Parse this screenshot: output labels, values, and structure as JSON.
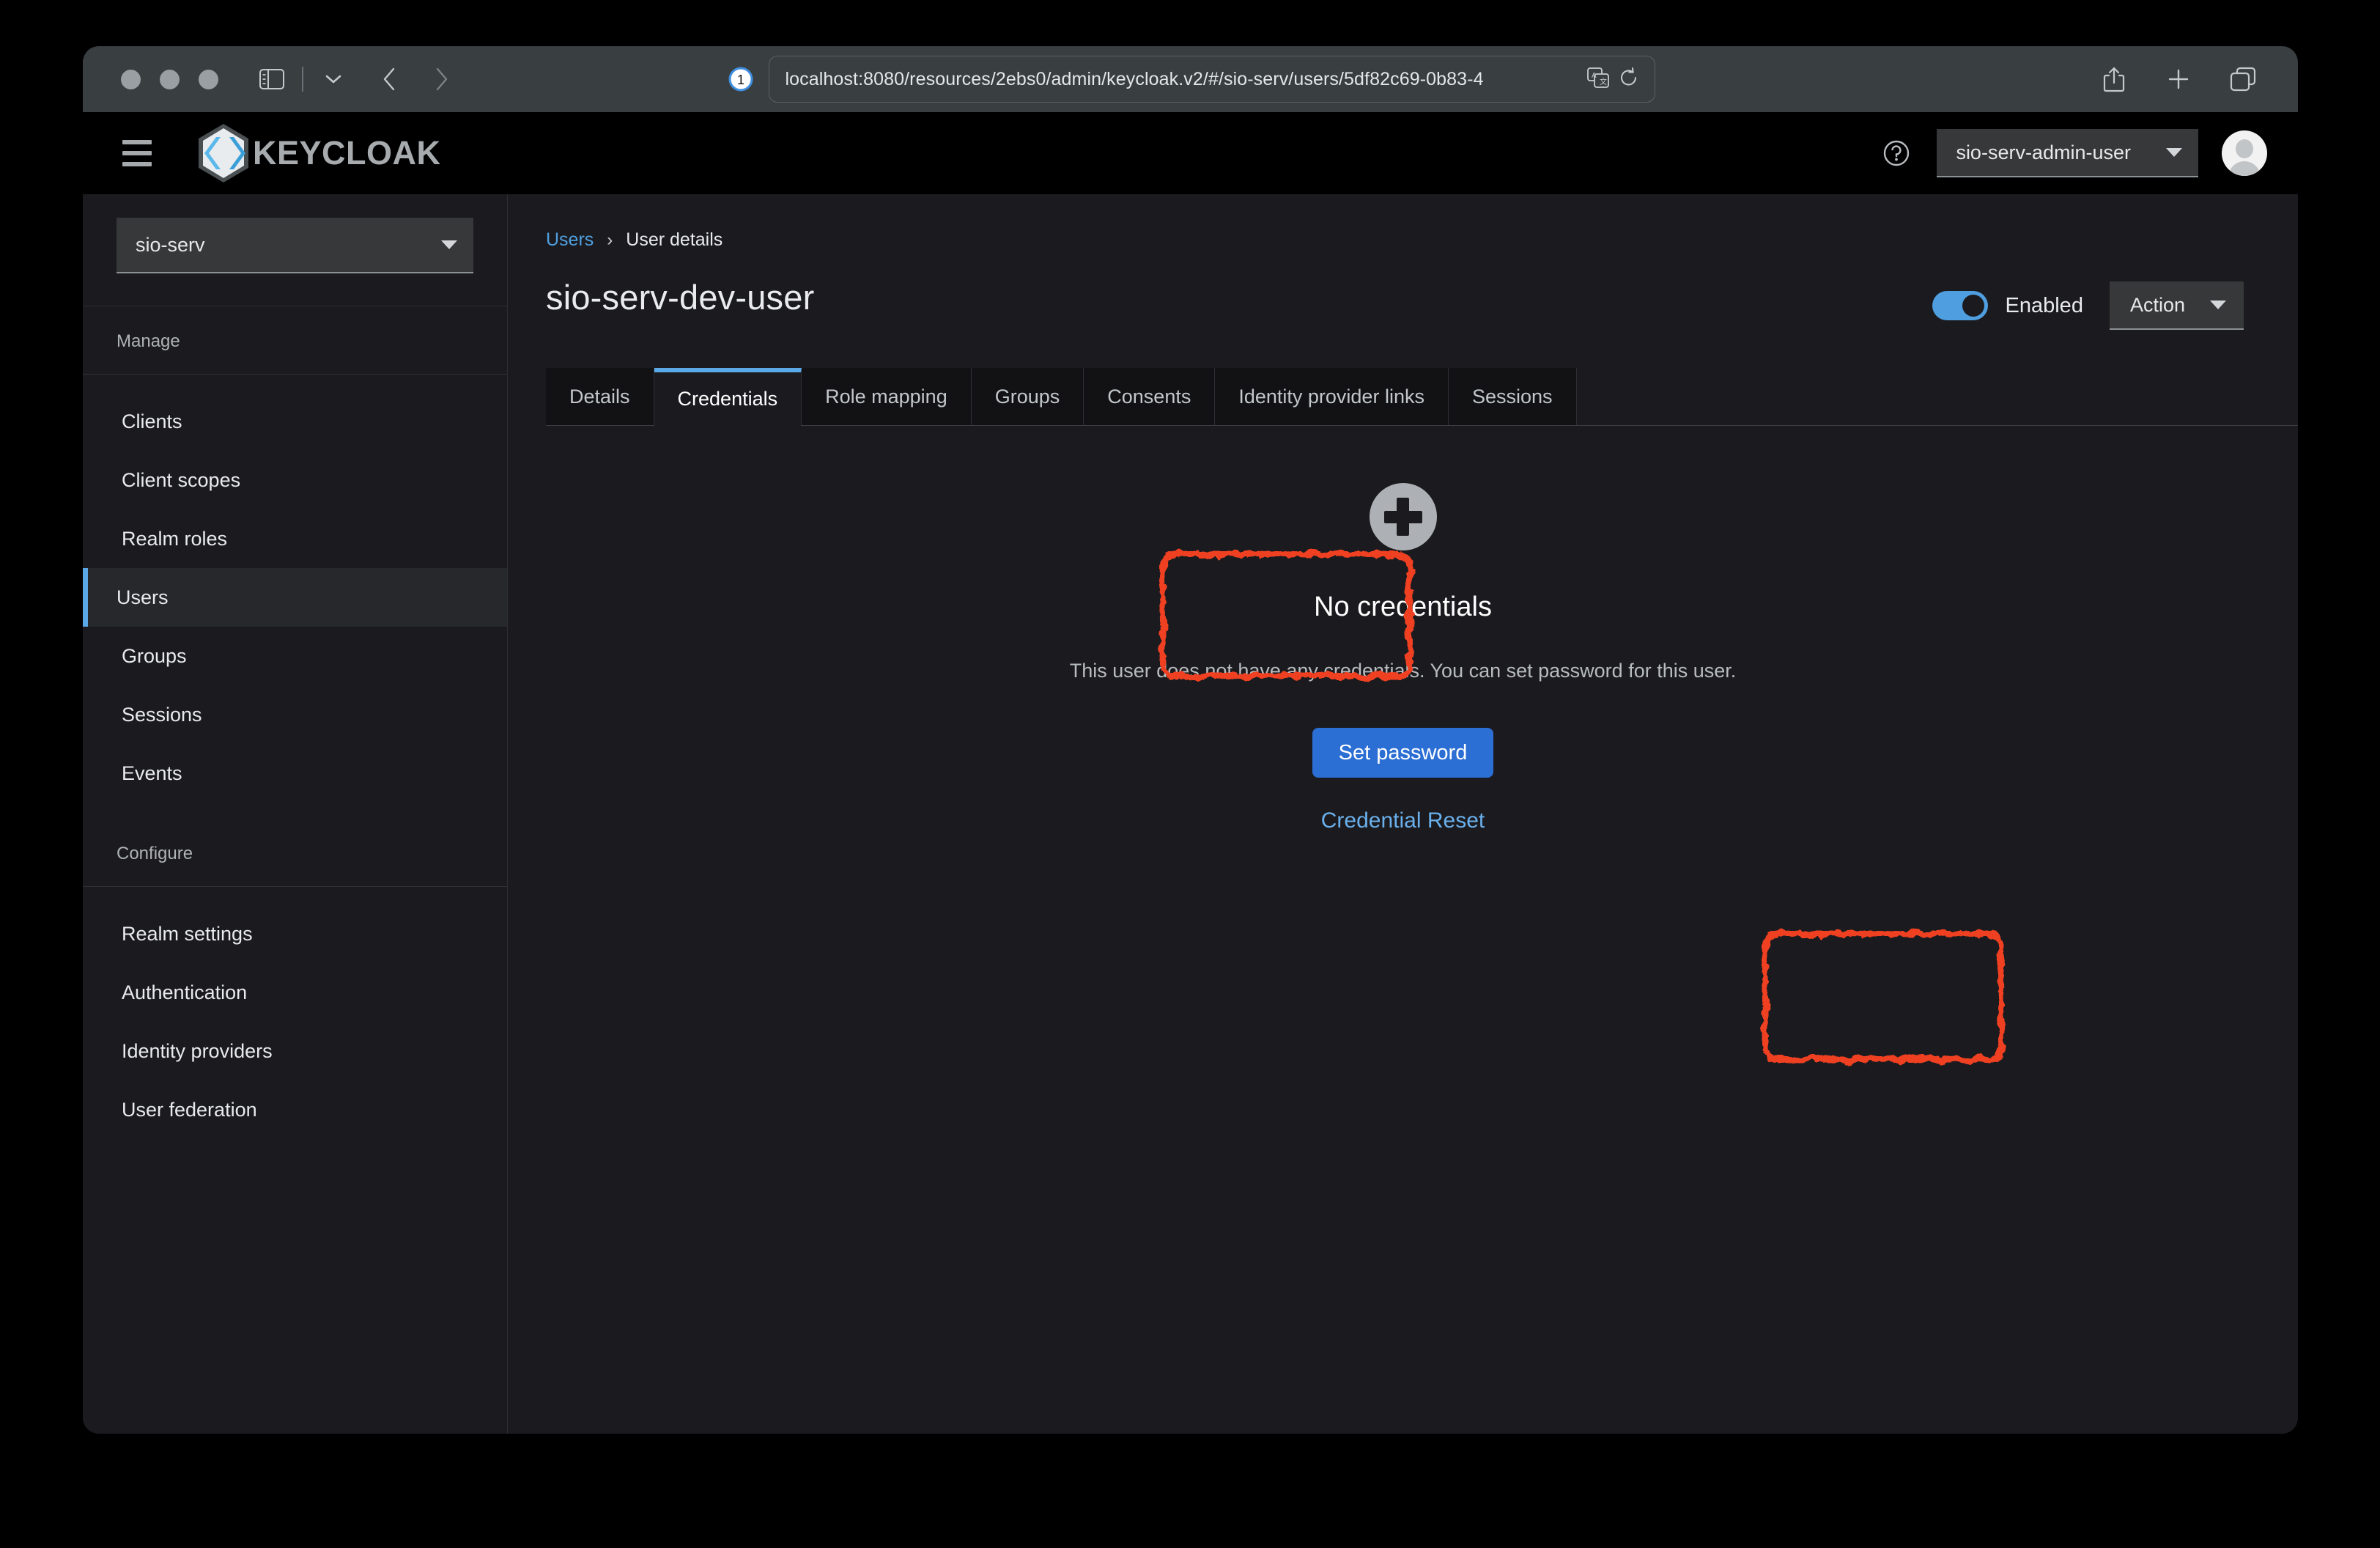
{
  "browser": {
    "url": "localhost:8080/resources/2ebs0/admin/keycloak.v2/#/sio-serv/users/5df82c69-0b83-4",
    "traffic_lights": [
      "close-button",
      "minimize-button",
      "maximize-button"
    ],
    "icons": {
      "sidebar_toggle": "sidebar-toggle-icon",
      "sidebar_chevron": "chevron-down-icon",
      "back": "back-arrow-icon",
      "forward": "forward-arrow-icon",
      "shield": "privacy-shield-icon",
      "translate": "translate-icon",
      "reload": "reload-icon",
      "share": "share-icon",
      "new_tab": "plus-icon",
      "tab_overview": "tab-overview-icon"
    }
  },
  "masthead": {
    "brand": "KEYCLOAK",
    "hamburger": "hamburger-menu-icon",
    "help": "help-circle-icon",
    "user": "sio-serv-admin-user",
    "avatar": "user-avatar"
  },
  "sidebar": {
    "realm": "sio-serv",
    "groups": [
      {
        "title": "Manage",
        "items": [
          {
            "label": "Clients",
            "active": false
          },
          {
            "label": "Client scopes",
            "active": false
          },
          {
            "label": "Realm roles",
            "active": false
          },
          {
            "label": "Users",
            "active": true
          },
          {
            "label": "Groups",
            "active": false
          },
          {
            "label": "Sessions",
            "active": false
          },
          {
            "label": "Events",
            "active": false
          }
        ]
      },
      {
        "title": "Configure",
        "items": [
          {
            "label": "Realm settings",
            "active": false
          },
          {
            "label": "Authentication",
            "active": false
          },
          {
            "label": "Identity providers",
            "active": false
          },
          {
            "label": "User federation",
            "active": false
          }
        ]
      }
    ]
  },
  "main": {
    "breadcrumb": {
      "root": "Users",
      "separator": "›",
      "current": "User details"
    },
    "title": "sio-serv-dev-user",
    "enabled_label": "Enabled",
    "enabled": true,
    "action_label": "Action",
    "tabs": [
      {
        "label": "Details",
        "active": false
      },
      {
        "label": "Credentials",
        "active": true
      },
      {
        "label": "Role mapping",
        "active": false
      },
      {
        "label": "Groups",
        "active": false
      },
      {
        "label": "Consents",
        "active": false
      },
      {
        "label": "Identity provider links",
        "active": false
      },
      {
        "label": "Sessions",
        "active": false
      }
    ],
    "empty_state": {
      "icon": "plus-circle-icon",
      "title": "No credentials",
      "description": "This user does not have any credentials. You can set password for this user.",
      "primary_button": "Set password",
      "secondary_link": "Credential Reset"
    }
  },
  "annotations": [
    {
      "name": "credentials-tab-highlight",
      "color": "#ef4123"
    },
    {
      "name": "set-password-highlight",
      "color": "#ef4123"
    }
  ]
}
